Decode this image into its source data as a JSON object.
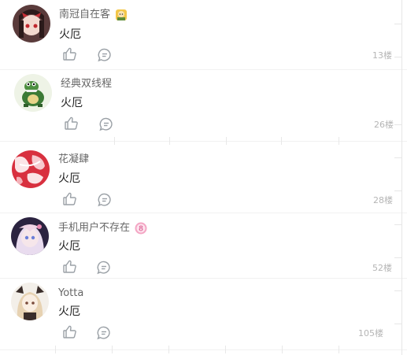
{
  "comments": [
    {
      "username": "南冠自在客",
      "badge_icon": "gold-avatar-badge-icon",
      "text": "火厄",
      "floor": "13楼"
    },
    {
      "username": "经典双线程",
      "badge_icon": "",
      "text": "火厄",
      "floor": "26楼"
    },
    {
      "username": "花凝肆",
      "badge_icon": "",
      "text": "火厄",
      "floor": "28楼"
    },
    {
      "username": "手机用户不存在",
      "badge_icon": "level-8-badge-icon",
      "badge_text": "8",
      "text": "火厄",
      "floor": "52楼"
    },
    {
      "username": "Yotta",
      "badge_icon": "",
      "text": "火厄",
      "floor": "105楼"
    }
  ],
  "colors": {
    "username": "#666666",
    "text": "#222222",
    "floor": "#b5b5b5",
    "icon": "#9aa0a6",
    "badge_pink": "#f4a6c4"
  },
  "icons": {
    "like": "thumbs-up-icon",
    "reply": "comment-bubble-icon"
  }
}
